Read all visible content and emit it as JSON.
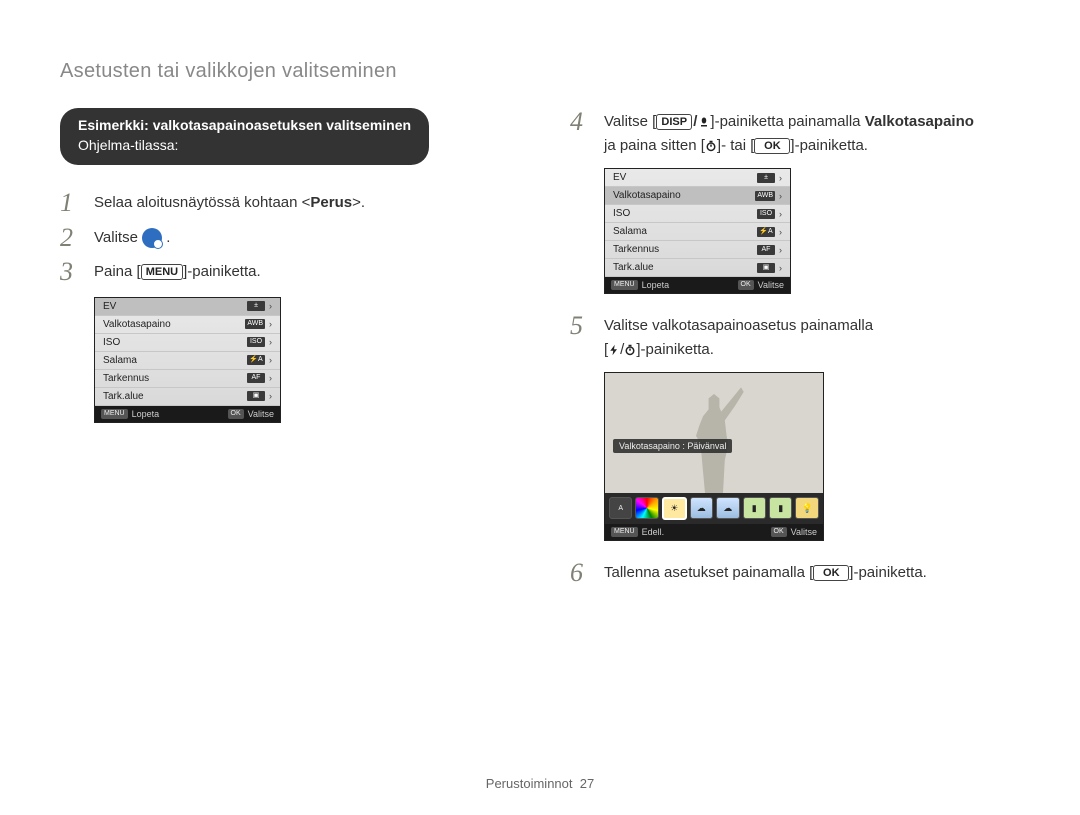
{
  "header": {
    "title": "Asetusten tai valikkojen valitseminen"
  },
  "pill": {
    "line1": "Esimerkki: valkotasapainoasetuksen valitseminen",
    "line2": "Ohjelma-tilassa:"
  },
  "steps": {
    "s1": {
      "num": "1",
      "text_a": "Selaa aloitusnäytössä kohtaan <",
      "bold": "Perus",
      "text_b": ">."
    },
    "s2": {
      "num": "2",
      "text_a": "Valitse ",
      "text_b": "."
    },
    "s3": {
      "num": "3",
      "text_a": "Paina [",
      "btn": "MENU",
      "text_b": "]-painiketta."
    },
    "s4": {
      "num": "4",
      "text_a": "Valitse [",
      "glyph_a": "DISP",
      "sep": "/",
      "text_b": "]-painiketta painamalla ",
      "bold": "Valkotasapaino",
      "line2_a": "ja paina sitten [",
      "line2_b": "]- tai [",
      "ok": "OK",
      "line2_c": "]-painiketta."
    },
    "s5": {
      "num": "5",
      "line1": "Valitse valkotasapainoasetus painamalla",
      "line2_a": "[",
      "sep": "/",
      "line2_b": "]-painiketta."
    },
    "s6": {
      "num": "6",
      "text_a": "Tallenna asetukset painamalla [",
      "ok": "OK",
      "text_b": "]-painiketta."
    }
  },
  "menu": {
    "rows": [
      {
        "label": "EV",
        "icon": "±"
      },
      {
        "label": "Valkotasapaino",
        "icon": "AWB"
      },
      {
        "label": "ISO",
        "icon": "ISO"
      },
      {
        "label": "Salama",
        "icon": "⚡A"
      },
      {
        "label": "Tarkennus",
        "icon": "AF"
      },
      {
        "label": "Tark.alue",
        "icon": "▣"
      }
    ],
    "selected_index_a": 0,
    "selected_index_b": 1,
    "footer": {
      "left_btn": "MENU",
      "left_label": "Lopeta",
      "right_btn": "OK",
      "right_label": "Valitse"
    }
  },
  "wb_screen": {
    "label": "Valkotasapaino : Päivänval",
    "footer": {
      "left_btn": "MENU",
      "left_label": "Edell.",
      "right_btn": "OK",
      "right_label": "Valitse"
    }
  },
  "footer": {
    "section": "Perustoiminnot",
    "page": "27"
  }
}
